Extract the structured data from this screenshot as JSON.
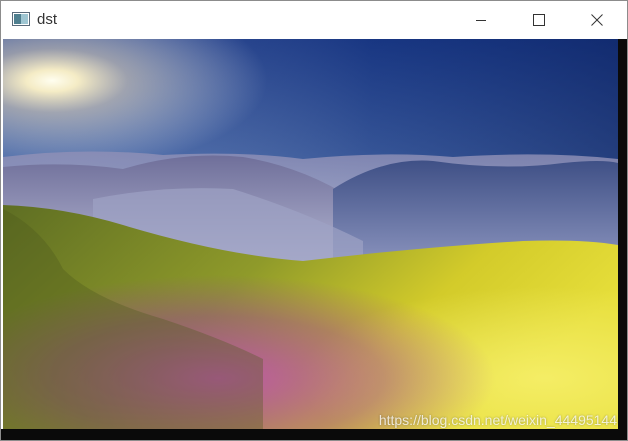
{
  "window": {
    "title": "dst",
    "controls": {
      "minimize_icon": "minimize-icon",
      "maximize_icon": "maximize-icon",
      "close_icon": "close-icon"
    }
  },
  "image": {
    "icon": "landscape-photo",
    "watermark": "https://blog.csdn.net/weixin_44495144"
  },
  "colors": {
    "sky_top": "#1b3d8c",
    "sun": "#fffbe6",
    "haze": "#c9c3d6",
    "meadow_yellow": "#c8c21f",
    "flowers": "#b43fb3",
    "border": "#0a0a0a"
  }
}
